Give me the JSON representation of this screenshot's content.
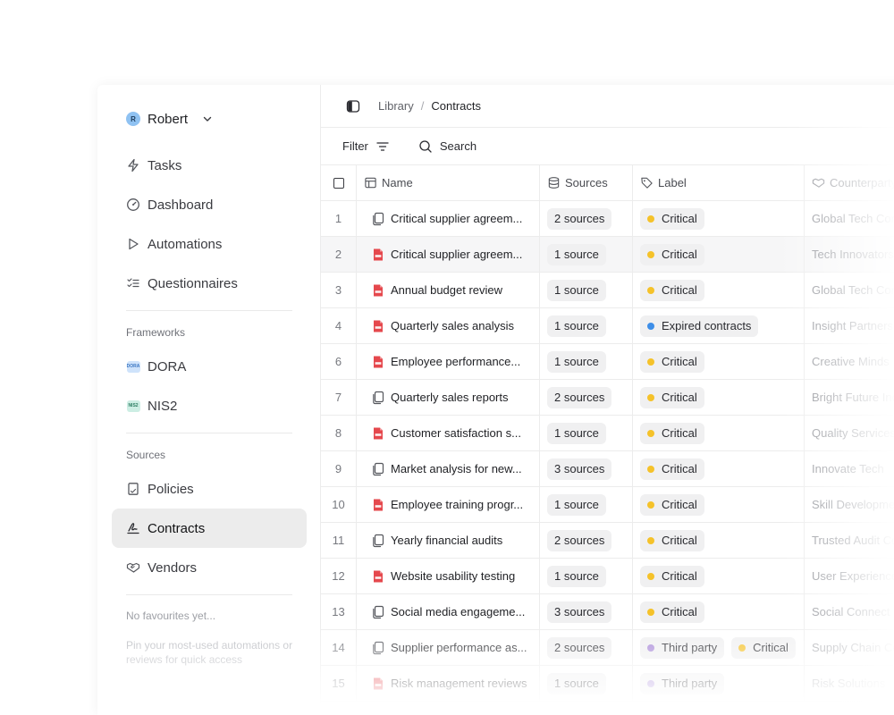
{
  "user": {
    "name": "Robert",
    "initial": "R"
  },
  "nav": {
    "tasks": "Tasks",
    "dashboard": "Dashboard",
    "automations": "Automations",
    "questionnaires": "Questionnaires"
  },
  "frameworks": {
    "section": "Frameworks",
    "dora": {
      "label": "DORA",
      "badge": "DORA"
    },
    "nis2": {
      "label": "NIS2",
      "badge": "NIS2"
    }
  },
  "sources": {
    "section": "Sources",
    "policies": "Policies",
    "contracts": "Contracts",
    "vendors": "Vendors"
  },
  "favourites": {
    "empty": "No favourites yet...",
    "hint": "Pin your most-used automations or reviews for quick access"
  },
  "breadcrumb": {
    "parent": "Library",
    "separator": "/",
    "current": "Contracts"
  },
  "toolbar": {
    "filter": "Filter",
    "search": "Search"
  },
  "table": {
    "columns": {
      "name": "Name",
      "sources": "Sources",
      "label": "Label",
      "counterparty": "Counterparty"
    },
    "rows": [
      {
        "num": "1",
        "type": "doc",
        "name": "Critical supplier agreem...",
        "sources": "2 sources",
        "labels": [
          {
            "text": "Critical",
            "color": "#f5c22a"
          }
        ],
        "counterparty": "Global Tech Corp"
      },
      {
        "num": "2",
        "type": "pdf",
        "name": "Critical supplier agreem...",
        "sources": "1 source",
        "labels": [
          {
            "text": "Critical",
            "color": "#f5c22a"
          }
        ],
        "counterparty": "Tech Innovators"
      },
      {
        "num": "3",
        "type": "pdf",
        "name": "Annual budget review",
        "sources": "1 source",
        "labels": [
          {
            "text": "Critical",
            "color": "#f5c22a"
          }
        ],
        "counterparty": "Global Tech Corp"
      },
      {
        "num": "4",
        "type": "pdf",
        "name": "Quarterly sales analysis",
        "sources": "1 source",
        "labels": [
          {
            "text": "Expired contracts",
            "color": "#3d8ee8"
          }
        ],
        "counterparty": "Insight Partners"
      },
      {
        "num": "6",
        "type": "pdf",
        "name": "Employee performance...",
        "sources": "1 source",
        "labels": [
          {
            "text": "Critical",
            "color": "#f5c22a"
          }
        ],
        "counterparty": "Creative Minds"
      },
      {
        "num": "7",
        "type": "doc",
        "name": "Quarterly sales reports",
        "sources": "2 sources",
        "labels": [
          {
            "text": "Critical",
            "color": "#f5c22a"
          }
        ],
        "counterparty": "Bright Future Inc"
      },
      {
        "num": "8",
        "type": "pdf",
        "name": "Customer satisfaction s...",
        "sources": "1 source",
        "labels": [
          {
            "text": "Critical",
            "color": "#f5c22a"
          }
        ],
        "counterparty": "Quality Services"
      },
      {
        "num": "9",
        "type": "doc",
        "name": "Market analysis for new...",
        "sources": "3 sources",
        "labels": [
          {
            "text": "Critical",
            "color": "#f5c22a"
          }
        ],
        "counterparty": "Innovate Tech"
      },
      {
        "num": "10",
        "type": "pdf",
        "name": "Employee training progr...",
        "sources": "1 source",
        "labels": [
          {
            "text": "Critical",
            "color": "#f5c22a"
          }
        ],
        "counterparty": "Skill Development"
      },
      {
        "num": "11",
        "type": "doc",
        "name": "Yearly financial audits",
        "sources": "2 sources",
        "labels": [
          {
            "text": "Critical",
            "color": "#f5c22a"
          }
        ],
        "counterparty": "Trusted Audit Co"
      },
      {
        "num": "12",
        "type": "pdf",
        "name": "Website usability testing",
        "sources": "1 source",
        "labels": [
          {
            "text": "Critical",
            "color": "#f5c22a"
          }
        ],
        "counterparty": "User Experience"
      },
      {
        "num": "13",
        "type": "doc",
        "name": "Social media engageme...",
        "sources": "3 sources",
        "labels": [
          {
            "text": "Critical",
            "color": "#f5c22a"
          }
        ],
        "counterparty": "Social Connect"
      },
      {
        "num": "14",
        "type": "doc",
        "name": "Supplier performance as...",
        "sources": "2 sources",
        "labels": [
          {
            "text": "Third party",
            "color": "#a98ad8"
          },
          {
            "text": "Critical",
            "color": "#f5c22a"
          }
        ],
        "counterparty": "Supply Chain Co"
      },
      {
        "num": "15",
        "type": "pdf",
        "name": "Risk management reviews",
        "sources": "1 source",
        "labels": [
          {
            "text": "Third party",
            "color": "#a98ad8"
          }
        ],
        "counterparty": "Risk Solutions"
      }
    ]
  },
  "colors": {
    "active_nav_bg": "#ececec",
    "pdf_red": "#e5484d",
    "critical": "#f5c22a",
    "expired": "#3d8ee8",
    "third_party": "#a98ad8"
  }
}
